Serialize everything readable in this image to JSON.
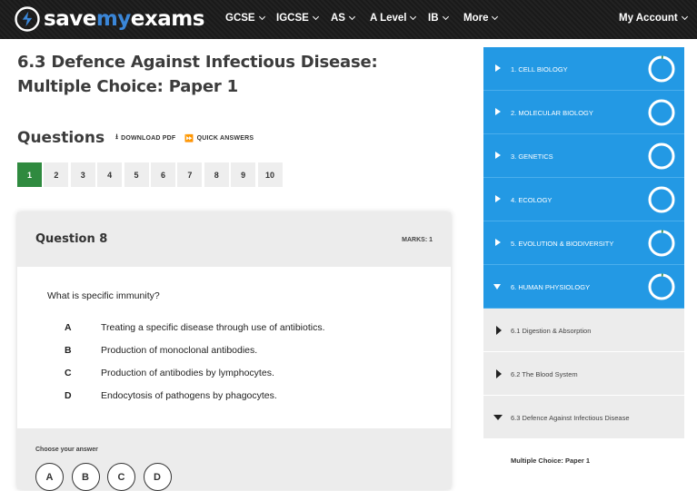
{
  "brand": {
    "word1": "save",
    "word2": "my",
    "word3": "exams",
    "accent": "#3a86d8",
    "icon": "lightning-bolt-icon"
  },
  "nav": {
    "items": [
      "GCSE",
      "IGCSE",
      "AS",
      "A Level",
      "IB",
      "More"
    ],
    "account": "My Account"
  },
  "page": {
    "title": "6.3 Defence Against Infectious Disease: Multiple Choice: Paper 1",
    "questions_heading": "Questions",
    "download_pdf": "DOWNLOAD PDF",
    "quick_answers": "QUICK ANSWERS",
    "pages": [
      "1",
      "2",
      "3",
      "4",
      "5",
      "6",
      "7",
      "8",
      "9",
      "10"
    ],
    "active_page": "1"
  },
  "question": {
    "heading": "Question 8",
    "marks": "MARKS: 1",
    "text": "What is specific immunity?",
    "options": [
      {
        "letter": "A",
        "text": "Treating a specific disease through use of antibiotics."
      },
      {
        "letter": "B",
        "text": "Production of monoclonal antibodies."
      },
      {
        "letter": "C",
        "text": "Production of antibodies by lymphocytes."
      },
      {
        "letter": "D",
        "text": "Endocytosis of pathogens by phagocytes."
      }
    ],
    "choose_label": "Choose your answer",
    "answer_buttons": [
      "A",
      "B",
      "C",
      "D"
    ]
  },
  "sidebar": {
    "topics": [
      {
        "label": "1. CELL BIOLOGY",
        "expanded": false,
        "progress": 0.02
      },
      {
        "label": "2. MOLECULAR BIOLOGY",
        "expanded": false,
        "progress": 0.0
      },
      {
        "label": "3. GENETICS",
        "expanded": false,
        "progress": 0.0
      },
      {
        "label": "4. ECOLOGY",
        "expanded": false,
        "progress": 0.0
      },
      {
        "label": "5. EVOLUTION & BIODIVERSITY",
        "expanded": false,
        "progress": 0.02
      },
      {
        "label": "6. HUMAN PHYSIOLOGY",
        "expanded": true,
        "progress": 0.02
      }
    ],
    "subtopics": [
      {
        "label": "6.1 Digestion & Absorption",
        "expanded": false
      },
      {
        "label": "6.2 The Blood System",
        "expanded": false
      },
      {
        "label": "6.3 Defence Against Infectious Disease",
        "expanded": true
      }
    ],
    "child": "Multiple Choice: Paper 1",
    "colors": {
      "topic_bg": "#2399e4",
      "progress": "#2f8a3f",
      "active_page": "#2f8a3f"
    }
  }
}
